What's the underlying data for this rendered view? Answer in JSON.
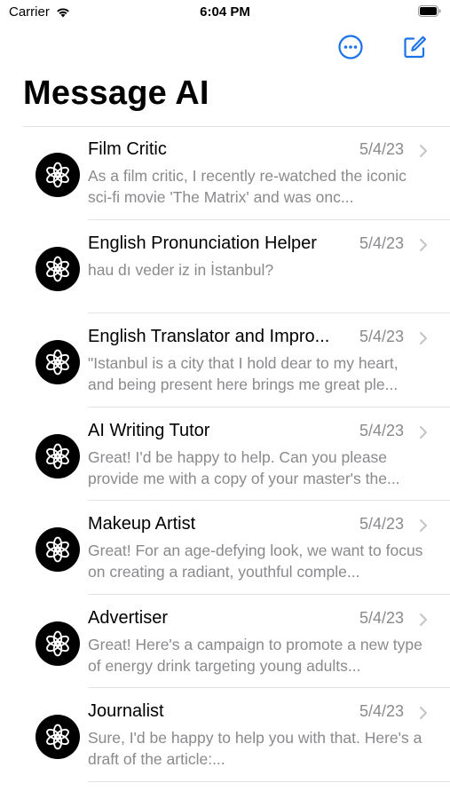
{
  "status_bar": {
    "carrier": "Carrier",
    "time": "6:04 PM"
  },
  "nav": {
    "more_icon": "ellipsis-circle-icon",
    "compose_icon": "compose-icon",
    "title": "Message AI"
  },
  "colors": {
    "accent": "#1a73e8",
    "secondary_text": "#8a8a8e",
    "separator": "#e2e2e6"
  },
  "conversations": [
    {
      "title": "Film Critic",
      "date": "5/4/23",
      "preview": "As a film critic, I recently re-watched the iconic sci-fi movie 'The Matrix' and was onc..."
    },
    {
      "title": "English Pronunciation Helper",
      "date": "5/4/23",
      "preview": "hau dı veder iz in İstanbul?"
    },
    {
      "title": "English Translator and Impro...",
      "date": "5/4/23",
      "preview": "\"Istanbul is a city that I hold dear to my heart, and being present here brings me great ple..."
    },
    {
      "title": "AI Writing Tutor",
      "date": "5/4/23",
      "preview": "Great! I'd be happy to help. Can you please provide me with a copy of your master's the..."
    },
    {
      "title": "Makeup Artist",
      "date": "5/4/23",
      "preview": "Great! For an age-defying look, we want to focus on creating a radiant, youthful comple..."
    },
    {
      "title": "Advertiser",
      "date": "5/4/23",
      "preview": "Great! Here's a campaign to promote a new type of energy drink targeting young adults..."
    },
    {
      "title": "Journalist",
      "date": "5/4/23",
      "preview": "Sure, I'd be happy to help you with that. Here's a draft of the article:..."
    }
  ]
}
